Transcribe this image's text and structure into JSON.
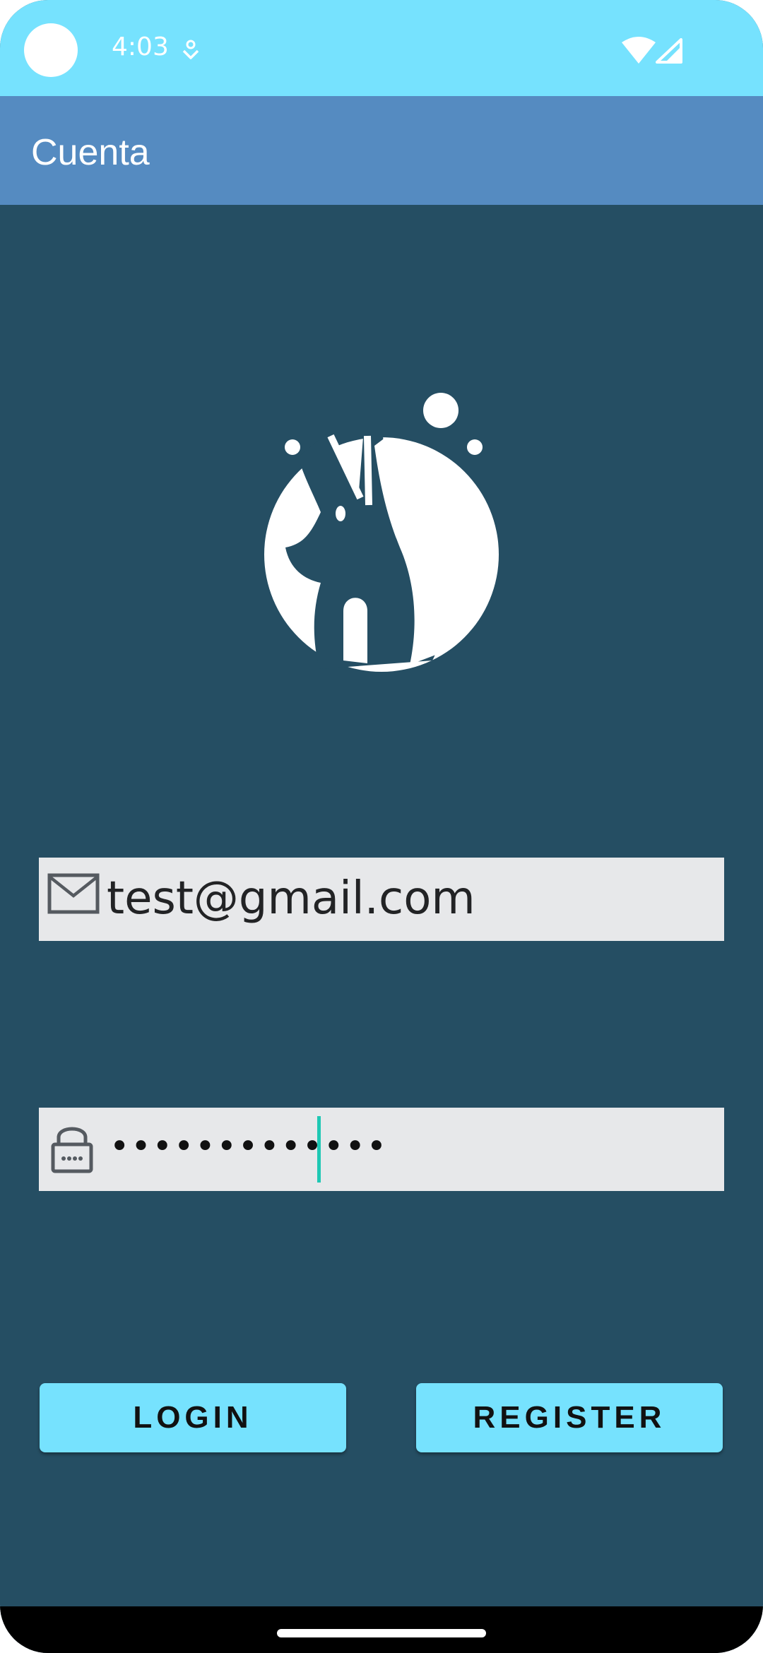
{
  "status_bar": {
    "time": "4:03",
    "icons": [
      "camera-dot",
      "download-indicator-icon",
      "wifi-icon",
      "cell-signal-icon"
    ]
  },
  "app_bar": {
    "title": "Cuenta"
  },
  "logo": {
    "icon": "dog-logo-icon"
  },
  "email_field": {
    "icon": "mail-icon",
    "value": "test@gmail.com"
  },
  "password_field": {
    "icon": "lock-icon",
    "value": "•••••••••••••"
  },
  "buttons": {
    "login": "LOGIN",
    "register": "REGISTER"
  },
  "colors": {
    "status_bar": "#76e2fe",
    "app_bar": "#558bc1",
    "background": "#254e63",
    "field": "#e7e8ea",
    "button": "#76e2fe",
    "cursor": "#1fc8b4"
  }
}
